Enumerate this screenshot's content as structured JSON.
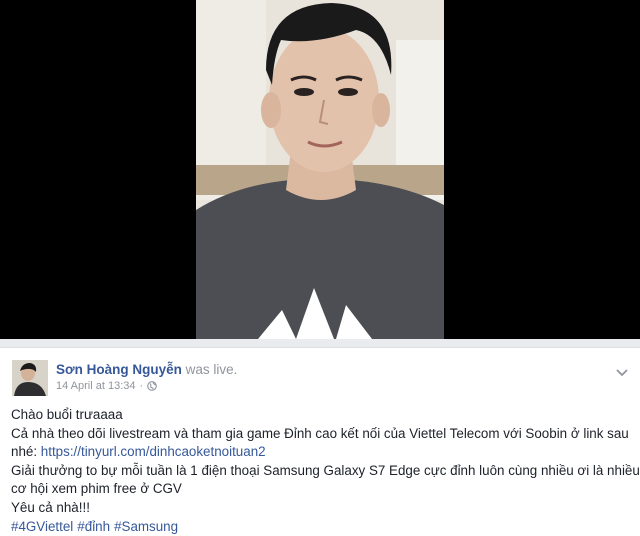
{
  "post": {
    "author_name": "Sơn Hoàng Nguyễn",
    "action_text": "was live.",
    "timestamp": "14 April at 13:34",
    "separator": "·",
    "privacy_icon": "globe-icon",
    "menu_icon": "chevron-down-icon",
    "lines": [
      "Chào buổi trưaaaa",
      "Cả nhà theo dõi livestream và tham gia game Đỉnh cao kết nối của Viettel Telecom với Soobin ở link sau"
    ],
    "link_prefix": "nhé: ",
    "link_url": "https://tinyurl.com/dinhcaoketnoituan2",
    "lines_after": [
      "Giải thưởng to bự mỗi tuần là 1 điện thoại Samsung Galaxy S7 Edge cực đỉnh luôn cùng nhiều ơi là nhiều",
      "cơ hội xem phim free ở CGV",
      "Yêu cả nhà!!!"
    ],
    "hashtags": [
      "#4GViettel",
      "#đỉnh",
      "#Samsung"
    ]
  },
  "colors": {
    "link": "#365899",
    "meta": "#90949c",
    "text": "#1d2129",
    "video_bg": "#000000"
  }
}
